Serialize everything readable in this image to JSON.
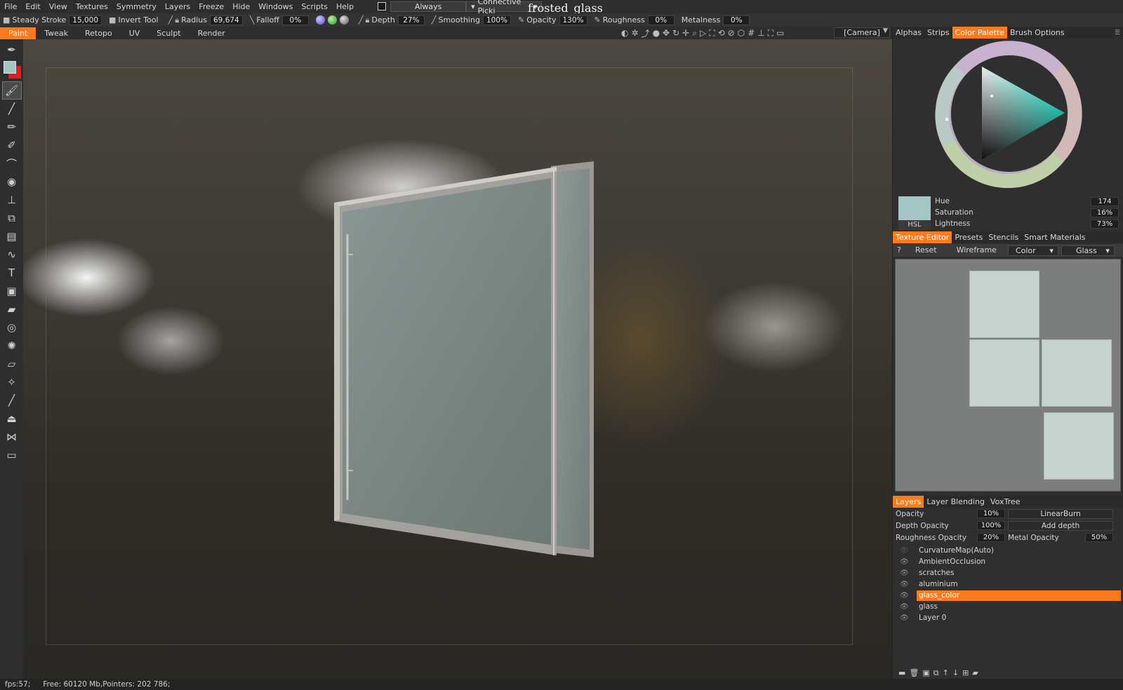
{
  "menubar": {
    "items": [
      "File",
      "Edit",
      "View",
      "Textures",
      "Symmetry",
      "Layers",
      "Freeze",
      "Hide",
      "Windows",
      "Scripts",
      "Help"
    ],
    "always_label": "Always",
    "connective_label": "Connective Picki",
    "title": "frosted_glass"
  },
  "toolbar": {
    "steady_stroke_label": "Steady  Stroke",
    "steady_stroke_value": "15,000",
    "invert_tool_label": "Invert  Tool",
    "radius_label": "Radius",
    "radius_value": "69,674",
    "falloff_label": "Falloff",
    "falloff_value": "0%",
    "depth_label": "Depth",
    "depth_value": "27%",
    "smoothing_label": "Smoothing",
    "smoothing_value": "100%",
    "opacity_label": "Opacity",
    "opacity_value": "130%",
    "roughness_label": "Roughness",
    "roughness_value": "0%",
    "metalness_label": "Metalness",
    "metalness_value": "0%"
  },
  "modes": {
    "tabs": [
      "Paint",
      "Tweak",
      "Retopo",
      "UV",
      "Sculpt",
      "Render"
    ],
    "active": "Paint",
    "camera_label": "[Camera]"
  },
  "right_panel": {
    "top_tabs": [
      "Alphas",
      "Strips",
      "Color Palette",
      "Brush  Options"
    ],
    "top_active": "Color Palette",
    "color": {
      "hex": "#a4c7c5",
      "mode_button": "HSL",
      "hue_label": "Hue",
      "hue_value": "174",
      "saturation_label": "Saturation",
      "saturation_value": "16%",
      "lightness_label": "Lightness",
      "lightness_value": "73%"
    },
    "mid_tabs": [
      "Texture  Editor",
      "Presets",
      "Stencils",
      "Smart  Materials"
    ],
    "mid_active": "Texture  Editor",
    "texture_editor": {
      "help": "?",
      "reset": "Reset",
      "wireframe": "Wireframe",
      "channel": "Color",
      "material": "Glass"
    },
    "layer_tabs": [
      "Layers",
      "Layer  Blending",
      "VoxTree"
    ],
    "layer_active": "Layers",
    "layer_controls": {
      "opacity_label": "Opacity",
      "opacity_value": "10%",
      "blend_mode": "LinearBurn",
      "depth_opacity_label": "Depth  Opacity",
      "depth_opacity_value": "100%",
      "depth_mode": "Add  depth",
      "roughness_opacity_label": "Roughness  Opacity",
      "roughness_opacity_value": "20%",
      "metal_opacity_label": "Metal  Opacity",
      "metal_opacity_value": "50%"
    },
    "layers": [
      {
        "name": "CurvatureMap(Auto)",
        "selected": false
      },
      {
        "name": "AmbientOcclusion",
        "selected": false
      },
      {
        "name": "scratches",
        "selected": false
      },
      {
        "name": "aluminium",
        "selected": false
      },
      {
        "name": "glass_color",
        "selected": true
      },
      {
        "name": "glass",
        "selected": false
      },
      {
        "name": "Layer  0",
        "selected": false
      }
    ]
  },
  "status": {
    "fps": "fps:57;",
    "memory": "Free:  60120  Mb,Pointers:  202  786;"
  },
  "accent_color": "#ff7a1a"
}
